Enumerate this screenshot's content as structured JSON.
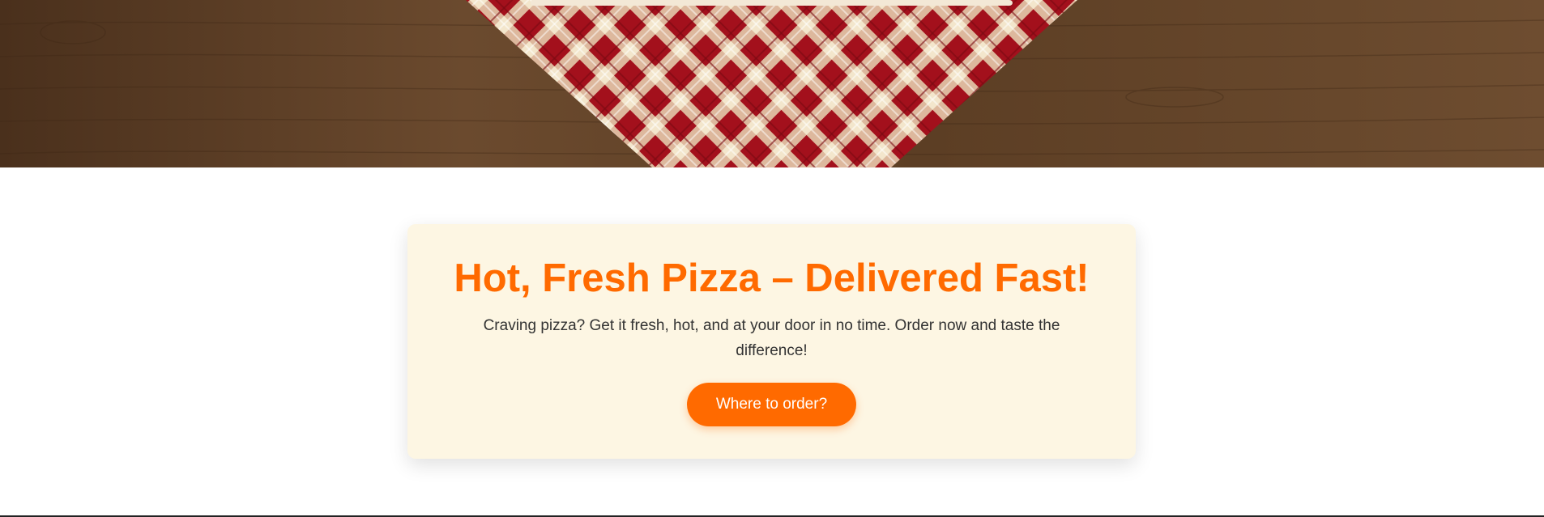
{
  "hero": {
    "image_name": "tablecloth-on-wood-image",
    "colors": {
      "wood": "#5a3d26",
      "cloth_red": "#a3101c",
      "cloth_cream": "#e8d6b4"
    }
  },
  "promo": {
    "title": "Hot, Fresh Pizza – Delivered Fast!",
    "text": "Craving pizza? Get it fresh, hot, and at your door in no time. Order now and taste the difference!",
    "button_label": "Where to order?",
    "colors": {
      "accent": "#ff6a00",
      "card_background": "#fdf6e3",
      "text": "#333333"
    }
  }
}
